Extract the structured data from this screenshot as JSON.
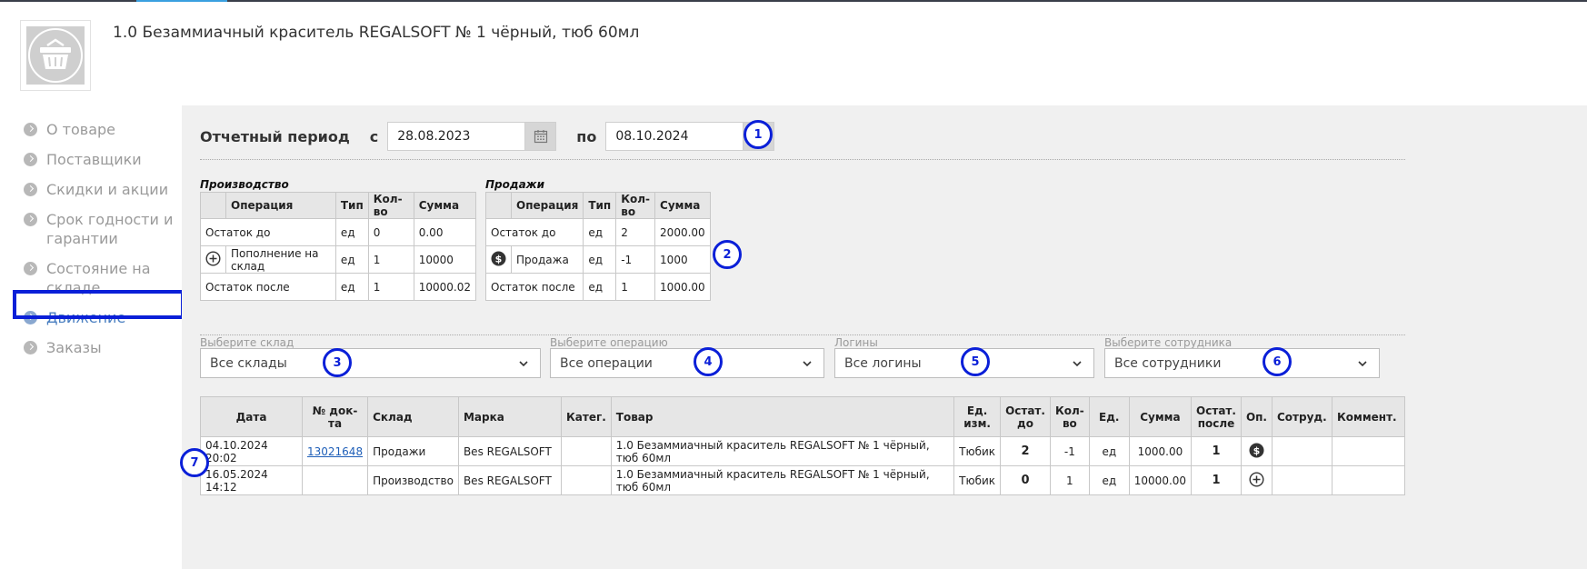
{
  "product": {
    "title": "1.0 Безаммиачный краситель REGALSOFT № 1 чёрный, тюб 60мл",
    "image_icon": "basket-icon"
  },
  "sidebar": {
    "items": [
      {
        "label": "О товаре",
        "active": false
      },
      {
        "label": "Поставщики",
        "active": false
      },
      {
        "label": "Скидки и акции",
        "active": false
      },
      {
        "label": "Срок годности и гарантии",
        "active": false
      },
      {
        "label": "Состояние на складе",
        "active": false
      },
      {
        "label": "Движение",
        "active": true
      },
      {
        "label": "Заказы",
        "active": false
      }
    ]
  },
  "period": {
    "label": "Отчетный период",
    "from_label": "с",
    "from_value": "28.08.2023",
    "to_label": "по",
    "to_value": "08.10.2024"
  },
  "production": {
    "title": "Производство",
    "headers": [
      "",
      "Операция",
      "Тип",
      "Кол-во",
      "Сумма"
    ],
    "rows": [
      {
        "op": "Остаток до",
        "icon": "",
        "type": "ед",
        "qty": "0",
        "sum": "0.00"
      },
      {
        "op": "Пополнение на склад",
        "icon": "plus-circle-icon",
        "type": "ед",
        "qty": "1",
        "sum": "10000"
      },
      {
        "op": "Остаток после",
        "icon": "",
        "type": "ед",
        "qty": "1",
        "sum": "10000.02"
      }
    ]
  },
  "sales": {
    "title": "Продажи",
    "headers": [
      "",
      "Операция",
      "Тип",
      "Кол-во",
      "Сумма"
    ],
    "rows": [
      {
        "op": "Остаток до",
        "icon": "",
        "type": "ед",
        "qty": "2",
        "sum": "2000.00"
      },
      {
        "op": "Продажа",
        "icon": "dollar-circle-icon",
        "type": "ед",
        "qty": "-1",
        "sum": "1000"
      },
      {
        "op": "Остаток после",
        "icon": "",
        "type": "ед",
        "qty": "1",
        "sum": "1000.00"
      }
    ]
  },
  "filters": {
    "warehouse": {
      "label": "Выберите склад",
      "value": "Все склады"
    },
    "operation": {
      "label": "Выберите операцию",
      "value": "Все операции"
    },
    "logins": {
      "label": "Логины",
      "value": "Все логины"
    },
    "employee": {
      "label": "Выберите сотрудника",
      "value": "Все сотрудники"
    }
  },
  "moves": {
    "headers": [
      "Дата",
      "№ док-та",
      "Склад",
      "Марка",
      "Катег.",
      "Товар",
      "Ед. изм.",
      "Остат. до",
      "Кол-во",
      "Ед.",
      "Сумма",
      "Остат. после",
      "Оп.",
      "Сотруд.",
      "Коммент."
    ],
    "rows": [
      {
        "date": "04.10.2024 20:02",
        "doc": "13021648",
        "warehouse": "Продажи",
        "brand": "Bes REGALSOFT",
        "category": "",
        "product": "1.0 Безаммиачный краситель REGALSOFT № 1 чёрный, тюб 60мл",
        "unit": "Тюбик",
        "before": "2",
        "qty": "-1",
        "u": "ед",
        "sum": "1000.00",
        "after": "1",
        "op_icon": "dollar-circle-icon",
        "employee": "",
        "comment": ""
      },
      {
        "date": "16.05.2024 14:12",
        "doc": "",
        "warehouse": "Производство",
        "brand": "Bes REGALSOFT",
        "category": "",
        "product": "1.0 Безаммиачный краситель REGALSOFT № 1 чёрный, тюб 60мл",
        "unit": "Тюбик",
        "before": "0",
        "qty": "1",
        "u": "ед",
        "sum": "10000.00",
        "after": "1",
        "op_icon": "plus-circle-icon",
        "employee": "",
        "comment": ""
      }
    ]
  },
  "annotations": [
    "1",
    "2",
    "3",
    "4",
    "5",
    "6",
    "7"
  ],
  "colors": {
    "annotation": "#0a1fd8",
    "active_nav": "#4a7fc1",
    "panel_bg": "#f0f0f0"
  }
}
